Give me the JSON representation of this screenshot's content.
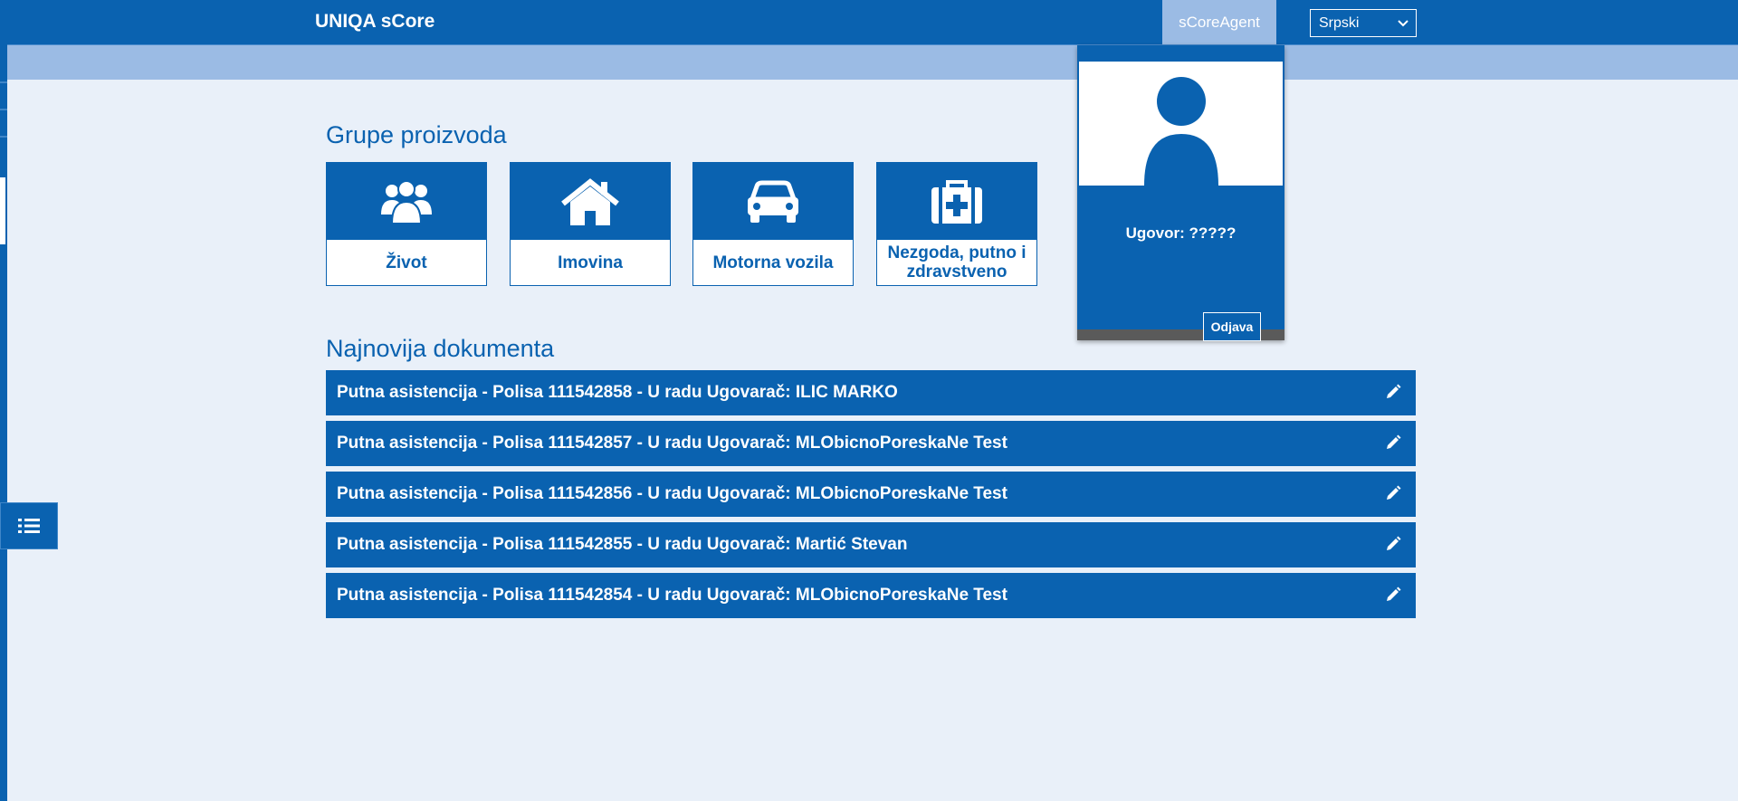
{
  "header": {
    "app_title": "UNIQA sCore",
    "agent_tab": "sCoreAgent",
    "language": {
      "selected": "Srpski"
    }
  },
  "product_groups": {
    "title": "Grupe proizvoda",
    "tiles": [
      {
        "label": "Život",
        "icon": "people-icon"
      },
      {
        "label": "Imovina",
        "icon": "house-icon"
      },
      {
        "label": "Motorna vozila",
        "icon": "car-icon"
      },
      {
        "label": "Nezgoda, putno i zdravstveno",
        "icon": "medical-kit-icon"
      }
    ]
  },
  "latest_documents": {
    "title": "Najnovija dokumenta",
    "rows": [
      {
        "text": "Putna asistencija - Polisa 111542858 - U radu Ugovarač: ILIC MARKO"
      },
      {
        "text": "Putna asistencija - Polisa 111542857 - U radu Ugovarač: MLObicnoPoreskaNe Test"
      },
      {
        "text": "Putna asistencija - Polisa 111542856 - U radu Ugovarač: MLObicnoPoreskaNe Test"
      },
      {
        "text": "Putna asistencija - Polisa 111542855 - U radu Ugovarač: Martić Stevan"
      },
      {
        "text": "Putna asistencija - Polisa 111542854 - U radu Ugovarač: MLObicnoPoreskaNe Test"
      }
    ]
  },
  "profile": {
    "contract": "Ugovor: ?????",
    "logout": "Odjava"
  },
  "colors": {
    "primary": "#0a62b0",
    "light_bar": "#9bbbe4",
    "background": "#e9f0f9"
  }
}
